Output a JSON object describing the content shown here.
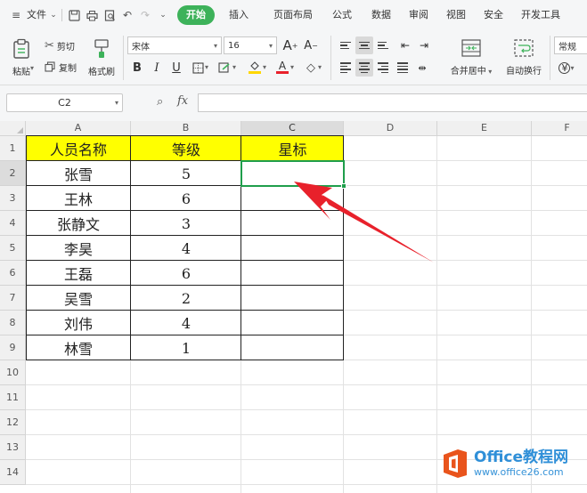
{
  "menubar": {
    "file_label": "文件",
    "tabs": [
      {
        "label": "开始",
        "active": true
      },
      {
        "label": "插入"
      },
      {
        "label": "页面布局"
      },
      {
        "label": "公式"
      },
      {
        "label": "数据"
      },
      {
        "label": "审阅"
      },
      {
        "label": "视图"
      },
      {
        "label": "安全"
      },
      {
        "label": "开发工具"
      }
    ],
    "accent_color": "#3db25a"
  },
  "ribbon": {
    "paste_label": "粘贴",
    "cut_label": "剪切",
    "copy_label": "复制",
    "format_painter_label": "格式刷",
    "font_name": "宋体",
    "font_size": "16",
    "grow_font": "A",
    "shrink_font": "A",
    "bold": "B",
    "italic": "I",
    "underline": "U",
    "font_color_glyph": "A",
    "merge_label": "合并居中",
    "wrap_label": "自动换行",
    "number_format": "常规"
  },
  "formulabar": {
    "cell_ref": "C2",
    "fx_label": "fx",
    "formula": ""
  },
  "sheet": {
    "columns": [
      "A",
      "B",
      "C",
      "D",
      "E",
      "F"
    ],
    "rows": [
      "1",
      "2",
      "3",
      "4",
      "5",
      "6",
      "7",
      "8",
      "9",
      "10",
      "11",
      "12",
      "13",
      "14"
    ],
    "selected_cell": "C2",
    "selection_color": "#1f9e4b",
    "header_fill_color": "#ffff00",
    "headers": [
      "人员名称",
      "等级",
      "星标"
    ],
    "data": [
      {
        "name": "张雪",
        "level": "5",
        "star": ""
      },
      {
        "name": "王林",
        "level": "6",
        "star": ""
      },
      {
        "name": "张静文",
        "level": "3",
        "star": ""
      },
      {
        "name": "李昊",
        "level": "4",
        "star": ""
      },
      {
        "name": "王磊",
        "level": "6",
        "star": ""
      },
      {
        "name": "吴雪",
        "level": "2",
        "star": ""
      },
      {
        "name": "刘伟",
        "level": "4",
        "star": ""
      },
      {
        "name": "林雪",
        "level": "1",
        "star": ""
      }
    ]
  },
  "annotation": {
    "arrow_color": "#e8212b"
  },
  "watermark": {
    "title": "Office教程网",
    "url": "www.office26.com"
  }
}
